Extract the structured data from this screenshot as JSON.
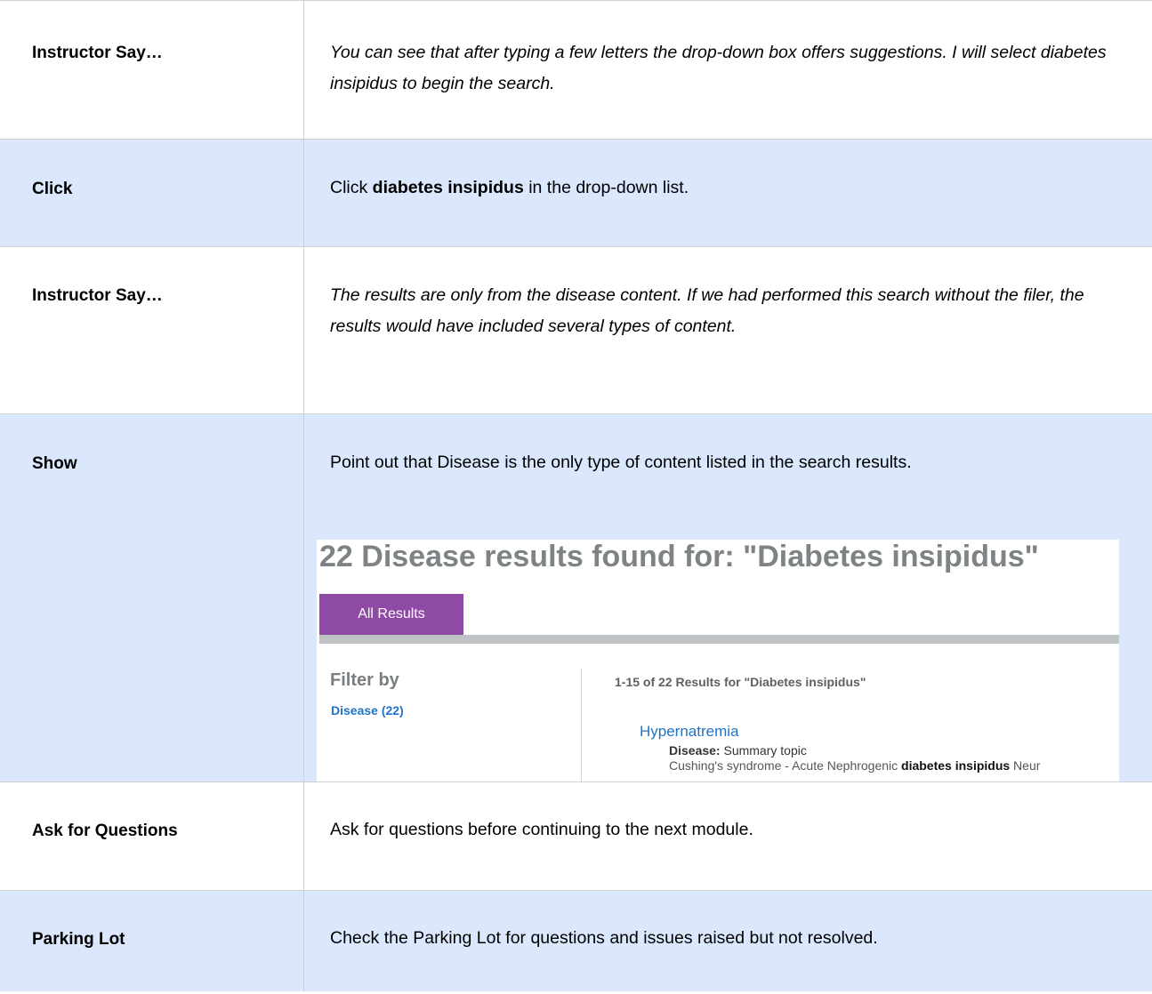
{
  "rows": [
    {
      "label": "Instructor Say…",
      "text": "You can see that after typing a few letters the drop-down box offers suggestions. I will select diabetes insipidus to begin the search."
    },
    {
      "label": "Click",
      "pre": "Click ",
      "bold": "diabetes insipidus",
      "post": " in the drop-down list."
    },
    {
      "label": "Instructor Say…",
      "text": "The results are only from the disease content. If we had performed this search without the filer, the results would have included several types of content."
    },
    {
      "label": "Show",
      "text": "Point out that Disease is the only type of content listed in the search results."
    },
    {
      "label": "Ask for Questions",
      "text": "Ask for questions before continuing to the next module."
    },
    {
      "label": "Parking Lot",
      "text": "Check the Parking Lot for questions and issues raised but not resolved."
    }
  ],
  "screenshot": {
    "title": "22 Disease results found for: \"Diabetes insipidus\"",
    "tab_label": "All Results",
    "filter_heading": "Filter by",
    "filter_link": "Disease (22)",
    "results_count": "1-15 of 22 Results for \"Diabetes insipidus\"",
    "result": {
      "title": "Hypernatremia",
      "type_label": "Disease:",
      "type_value": " Summary topic",
      "snippet_pre": "Cushing's syndrome - Acute Nephrogenic ",
      "snippet_bold": "diabetes insipidus",
      "snippet_post": " Neur"
    }
  },
  "colors": {
    "row_blue": "#dae7fd",
    "tab_purple": "#8f4aa6",
    "link_blue": "#1f73c9"
  }
}
